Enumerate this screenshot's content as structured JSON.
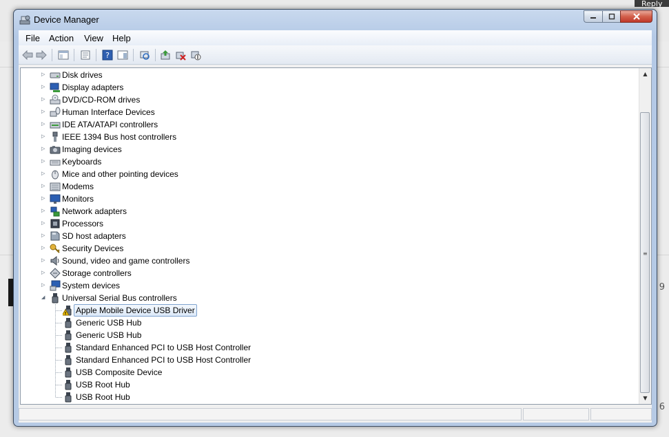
{
  "window": {
    "title": "Device Manager"
  },
  "background": {
    "reply_label": "Reply",
    "side_numbers": [
      "9",
      "6"
    ]
  },
  "menu": {
    "items": [
      "File",
      "Action",
      "View",
      "Help"
    ]
  },
  "toolbar": {
    "buttons": [
      "back-icon",
      "forward-icon",
      "show-hide-console-tree-icon",
      "properties-icon",
      "help-icon",
      "action-pane-icon",
      "scan-hardware-icon",
      "update-driver-icon",
      "uninstall-icon",
      "disable-icon"
    ]
  },
  "tree": {
    "categories": [
      {
        "label": "Disk drives",
        "icon": "disk-drive-icon",
        "expanded": false
      },
      {
        "label": "Display adapters",
        "icon": "display-adapter-icon",
        "expanded": false
      },
      {
        "label": "DVD/CD-ROM drives",
        "icon": "dvd-drive-icon",
        "expanded": false
      },
      {
        "label": "Human Interface Devices",
        "icon": "hid-icon",
        "expanded": false
      },
      {
        "label": "IDE ATA/ATAPI controllers",
        "icon": "ide-controller-icon",
        "expanded": false
      },
      {
        "label": "IEEE 1394 Bus host controllers",
        "icon": "ieee1394-icon",
        "expanded": false
      },
      {
        "label": "Imaging devices",
        "icon": "camera-icon",
        "expanded": false
      },
      {
        "label": "Keyboards",
        "icon": "keyboard-icon",
        "expanded": false
      },
      {
        "label": "Mice and other pointing devices",
        "icon": "mouse-icon",
        "expanded": false
      },
      {
        "label": "Modems",
        "icon": "modem-icon",
        "expanded": false
      },
      {
        "label": "Monitors",
        "icon": "monitor-icon",
        "expanded": false
      },
      {
        "label": "Network adapters",
        "icon": "network-adapter-icon",
        "expanded": false
      },
      {
        "label": "Processors",
        "icon": "processor-icon",
        "expanded": false
      },
      {
        "label": "SD host adapters",
        "icon": "sd-card-icon",
        "expanded": false
      },
      {
        "label": "Security Devices",
        "icon": "key-icon",
        "expanded": false
      },
      {
        "label": "Sound, video and game controllers",
        "icon": "speaker-icon",
        "expanded": false
      },
      {
        "label": "Storage controllers",
        "icon": "storage-controller-icon",
        "expanded": false
      },
      {
        "label": "System devices",
        "icon": "system-device-icon",
        "expanded": false
      },
      {
        "label": "Universal Serial Bus controllers",
        "icon": "usb-icon",
        "expanded": true
      }
    ],
    "usb_children": [
      {
        "label": "Apple Mobile Device USB Driver",
        "warning": true,
        "selected": true
      },
      {
        "label": "Generic USB Hub"
      },
      {
        "label": "Generic USB Hub"
      },
      {
        "label": "Standard Enhanced PCI to USB Host Controller"
      },
      {
        "label": "Standard Enhanced PCI to USB Host Controller"
      },
      {
        "label": "USB Composite Device"
      },
      {
        "label": "USB Root Hub"
      },
      {
        "label": "USB Root Hub"
      }
    ]
  },
  "colors": {
    "title_bar": "#b9cce7",
    "close_button": "#c9483a",
    "selection_border": "#7da2ce",
    "warning": "#f2c200"
  }
}
